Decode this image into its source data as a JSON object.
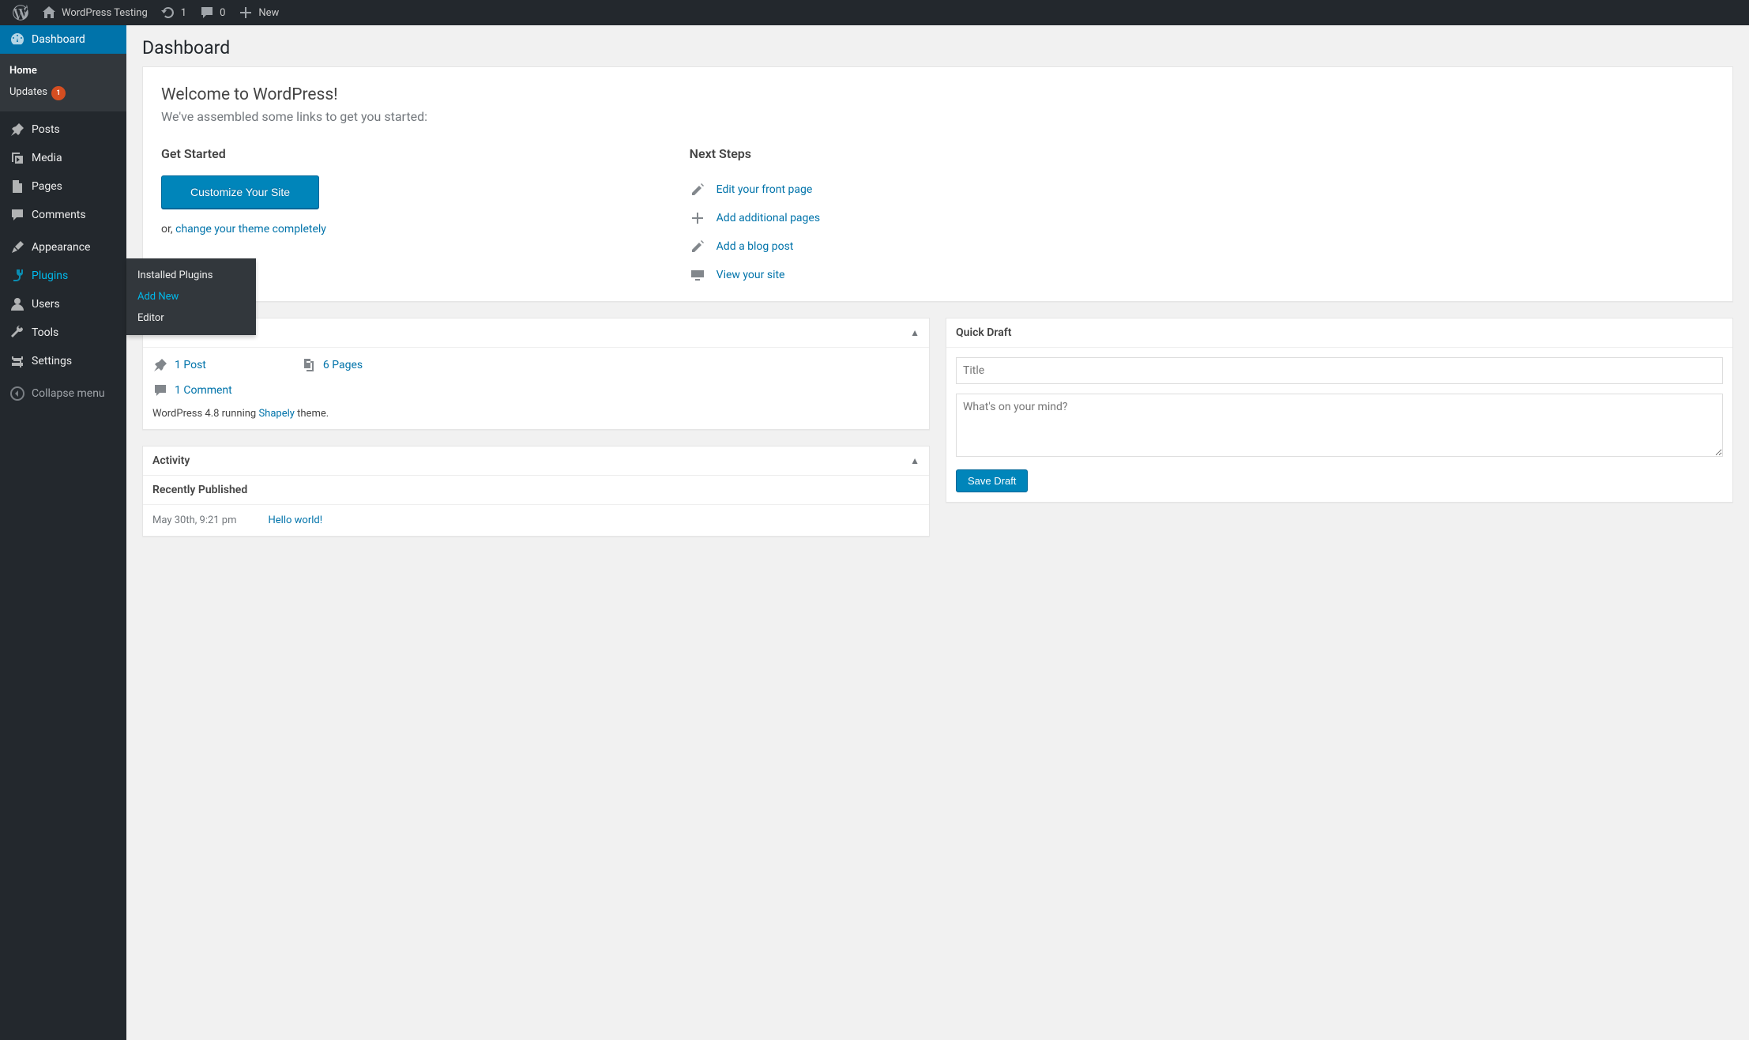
{
  "adminbar": {
    "site_name": "WordPress Testing",
    "updates": "1",
    "comments": "0",
    "new": "New"
  },
  "sidebar": {
    "dashboard": "Dashboard",
    "home": "Home",
    "updates": "Updates",
    "updates_badge": "1",
    "posts": "Posts",
    "media": "Media",
    "pages": "Pages",
    "comments": "Comments",
    "appearance": "Appearance",
    "plugins": "Plugins",
    "plugins_submenu": {
      "installed": "Installed Plugins",
      "add_new": "Add New",
      "editor": "Editor"
    },
    "users": "Users",
    "tools": "Tools",
    "settings": "Settings",
    "collapse": "Collapse menu"
  },
  "page": {
    "title": "Dashboard"
  },
  "welcome": {
    "heading": "Welcome to WordPress!",
    "sub": "We've assembled some links to get you started:",
    "get_started": "Get Started",
    "customize": "Customize Your Site",
    "or_prefix": "or, ",
    "change_theme": "change your theme completely",
    "next_steps": "Next Steps",
    "ns": {
      "edit_front": "Edit your front page",
      "add_pages": "Add additional pages",
      "add_post": "Add a blog post",
      "view_site": "View your site"
    }
  },
  "glance": {
    "post": "1 Post",
    "pages": "6 Pages",
    "comment": "1 Comment",
    "version_prefix": "WordPress 4.8 running ",
    "theme": "Shapely",
    "version_suffix": " theme."
  },
  "activity": {
    "title": "Activity",
    "recently": "Recently Published",
    "date": "May 30th, 9:21 pm",
    "post": "Hello world!"
  },
  "quickdraft": {
    "title": "Quick Draft",
    "placeholder_title": "Title",
    "placeholder_body": "What's on your mind?",
    "save": "Save Draft"
  }
}
